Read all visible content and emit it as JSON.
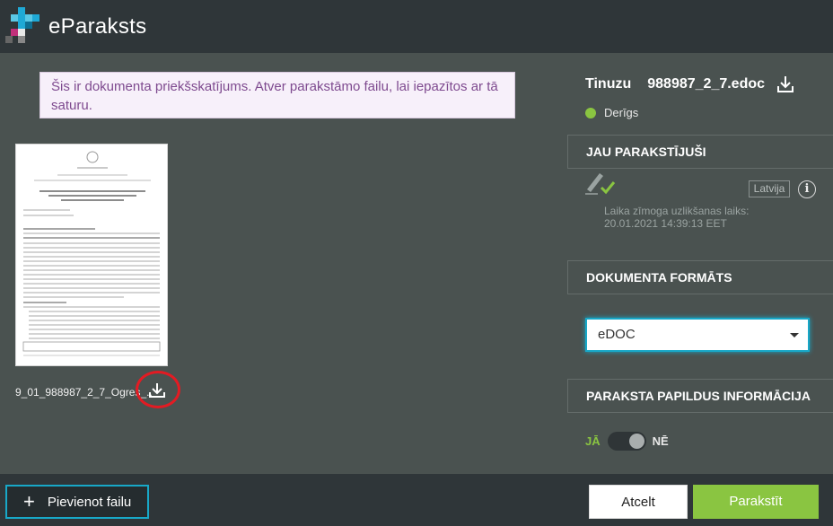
{
  "app": {
    "brand": "eParaksts"
  },
  "notice": {
    "text": "Šis ir dokumenta priekšskatījums. Atver parakstāmo failu, lai iepazītos ar tā saturu."
  },
  "document": {
    "name": "9_01_988987_2_7_Ogres_..",
    "download_icon": "download-icon"
  },
  "panel": {
    "container_type": "Tinuzu",
    "file_name": "988987_2_7.edoc",
    "status": "Derīgs",
    "status_color": "#8ac541"
  },
  "signers": {
    "title": "JAU PARAKSTĪJUŠI",
    "country": "Latvija",
    "info_icon_label": "i",
    "timestamp_label": "Laika zīmoga uzlikšanas laiks:",
    "timestamp_value": "20.01.2021 14:39:13 EET"
  },
  "format": {
    "title": "DOKUMENTA FORMĀTS",
    "selected": "eDOC"
  },
  "extra": {
    "title": "PARAKSTA PAPILDUS INFORMĀCIJA",
    "toggle_on": "JĀ",
    "toggle_off": "NĒ"
  },
  "footer": {
    "add_file": "Pievienot failu",
    "cancel": "Atcelt",
    "sign": "Parakstīt"
  },
  "colors": {
    "accent": "#18a8c8",
    "success": "#8ac541",
    "notice_text": "#7e4a8f"
  }
}
